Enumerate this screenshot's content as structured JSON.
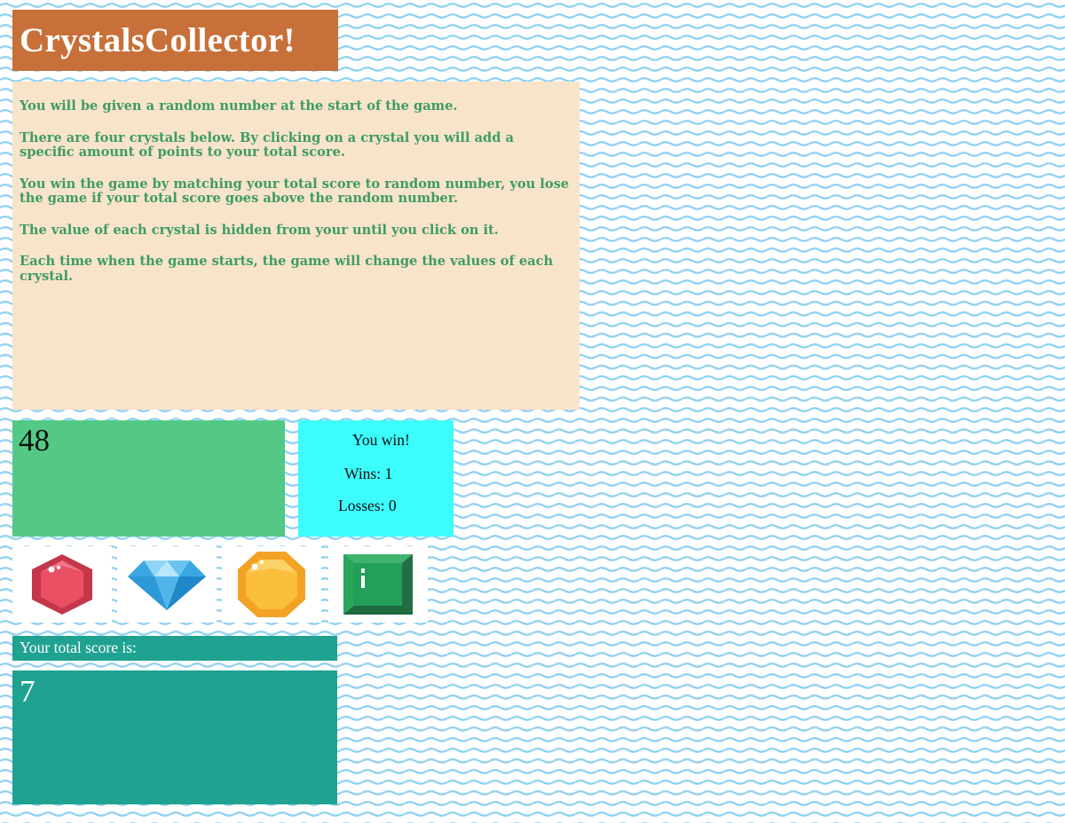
{
  "game": {
    "title": "CrystalsCollector!",
    "instructions": [
      "You will be given a random number at the start of the game.",
      "There are four crystals below. By clicking on a crystal you will add a specific amount of points to your total score.",
      "You win the game by matching your total score to random number, you lose the game if your total score goes above the random number.",
      "The value of each crystal is hidden from your until you click on it.",
      "Each time when the game starts, the game will change the values of each crystal."
    ],
    "target_number": "48",
    "status_message": "You win!",
    "wins_text": "Wins: 1",
    "losses_text": "Losses: 0",
    "crystals": [
      {
        "name": "red-hexagon-gem-icon",
        "color": "#e8475c"
      },
      {
        "name": "blue-diamond-gem-icon",
        "color": "#3aa7e4"
      },
      {
        "name": "yellow-octagon-gem-icon",
        "color": "#fbb935"
      },
      {
        "name": "green-square-gem-icon",
        "color": "#2aa55c"
      }
    ],
    "score_label": "Your total score is:",
    "total_score": "7"
  },
  "colors": {
    "title_bg": "#c8703a",
    "instructions_bg": "#f8e3cb",
    "instructions_text": "#3d9c62",
    "target_bg": "#54c986",
    "stats_bg": "#3cfcfc",
    "score_bg": "#20a292",
    "wave_pattern": "#8fd0f2"
  }
}
